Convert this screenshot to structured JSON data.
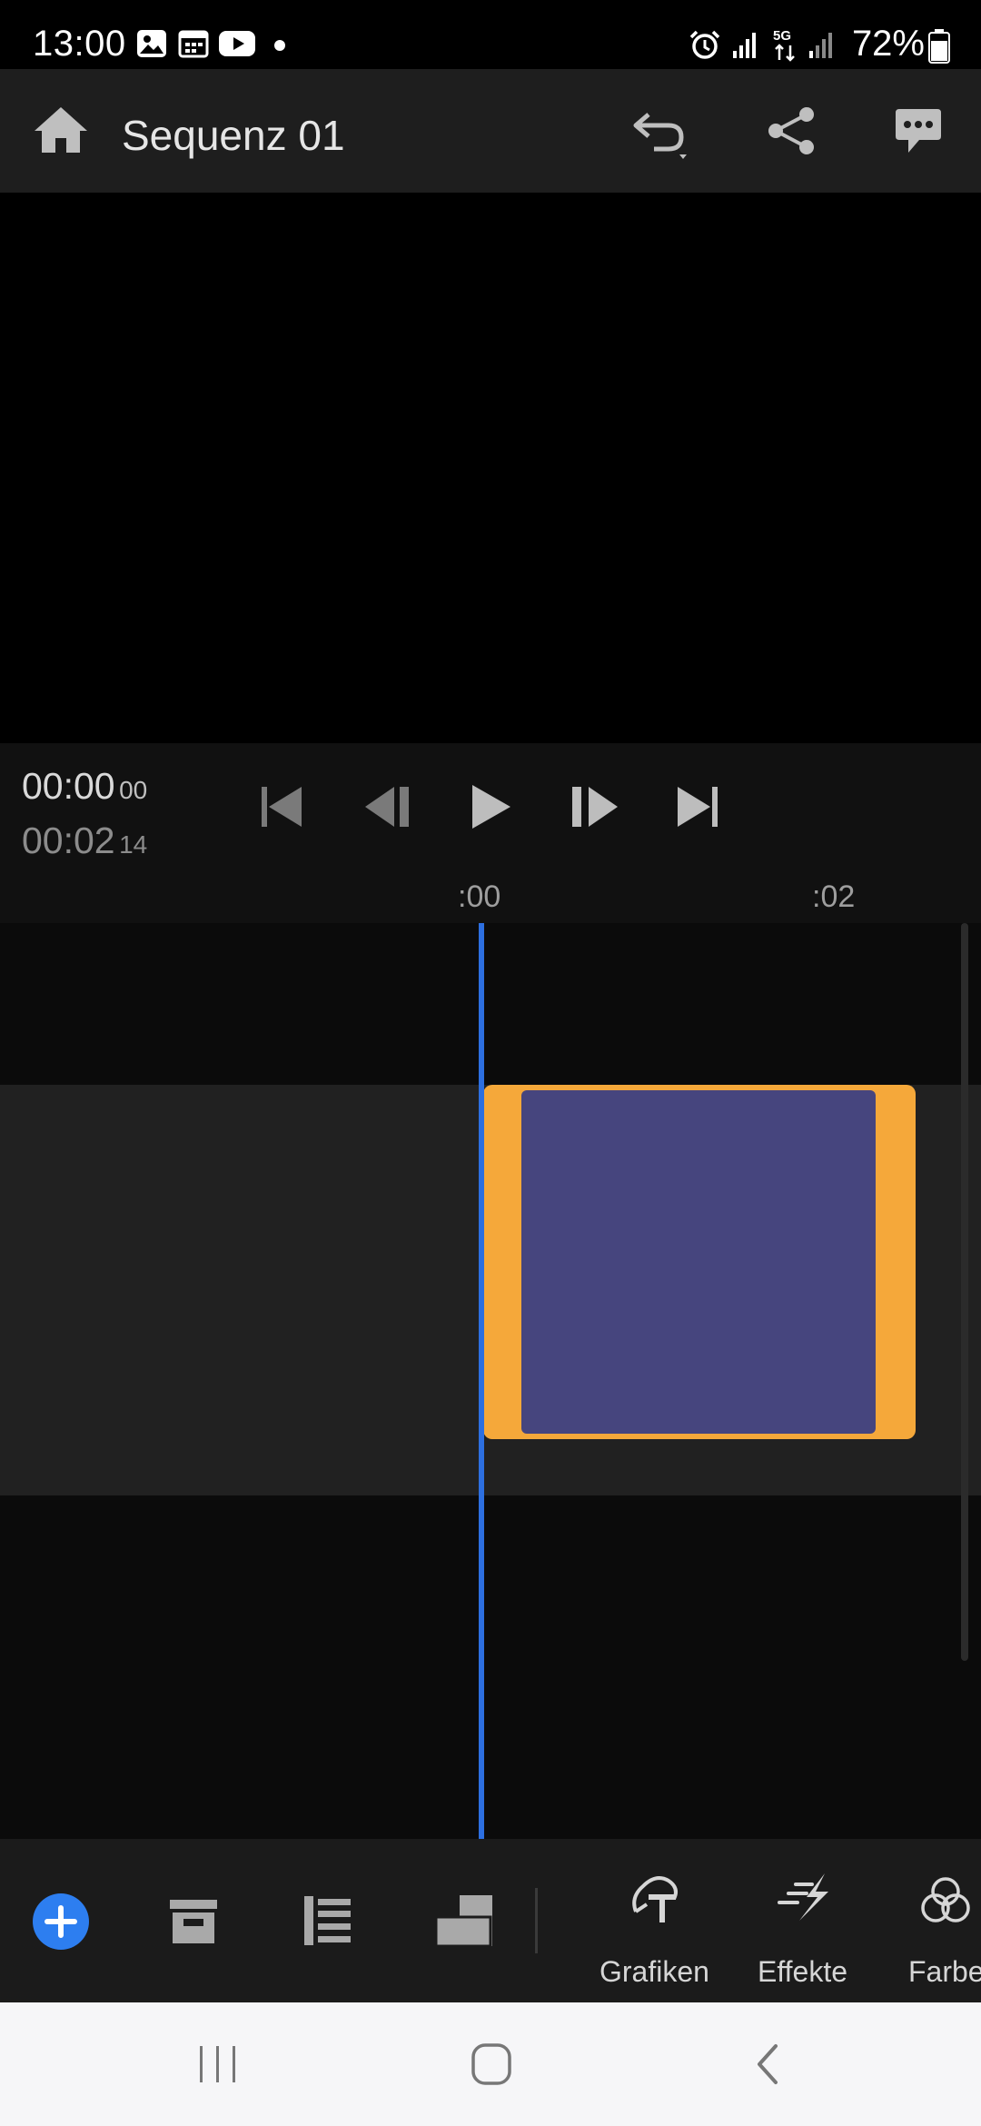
{
  "status_bar": {
    "time": "13:00",
    "battery_percent": "72%",
    "icons": [
      "gallery-icon",
      "calendar-icon",
      "youtube-icon",
      "dot-icon",
      "alarm-icon",
      "signal-icon",
      "5g-icon",
      "signal-icon",
      "battery-icon"
    ]
  },
  "header": {
    "title": "Sequenz 01",
    "icons": [
      "home-icon",
      "undo-icon",
      "share-icon",
      "comment-icon"
    ]
  },
  "transport": {
    "current_time": "00:00",
    "current_frames": "00",
    "duration_time": "00:02",
    "duration_frames": "14",
    "controls": [
      "skip-to-start-icon",
      "step-back-icon",
      "play-icon",
      "step-forward-icon",
      "skip-to-end-icon"
    ]
  },
  "ruler": {
    "marks": [
      ":00",
      ":02"
    ]
  },
  "toolbar": {
    "items": [
      {
        "icon": "add-icon",
        "label": ""
      },
      {
        "icon": "archive-icon",
        "label": ""
      },
      {
        "icon": "layers-list-icon",
        "label": ""
      },
      {
        "icon": "aspect-ratio-icon",
        "label": ""
      },
      {
        "icon": "graphics-icon",
        "label": "Grafiken"
      },
      {
        "icon": "effects-icon",
        "label": "Effekte"
      },
      {
        "icon": "color-icon",
        "label": "Farbe"
      }
    ]
  },
  "colors": {
    "accent_blue": "#2d6fe0",
    "clip_border": "#f5a83a",
    "clip_fill": "#46457e",
    "add_button": "#2d7ef0"
  },
  "nav_bar": {
    "icons": [
      "recent-apps-icon",
      "home-circle-icon",
      "back-icon"
    ]
  }
}
